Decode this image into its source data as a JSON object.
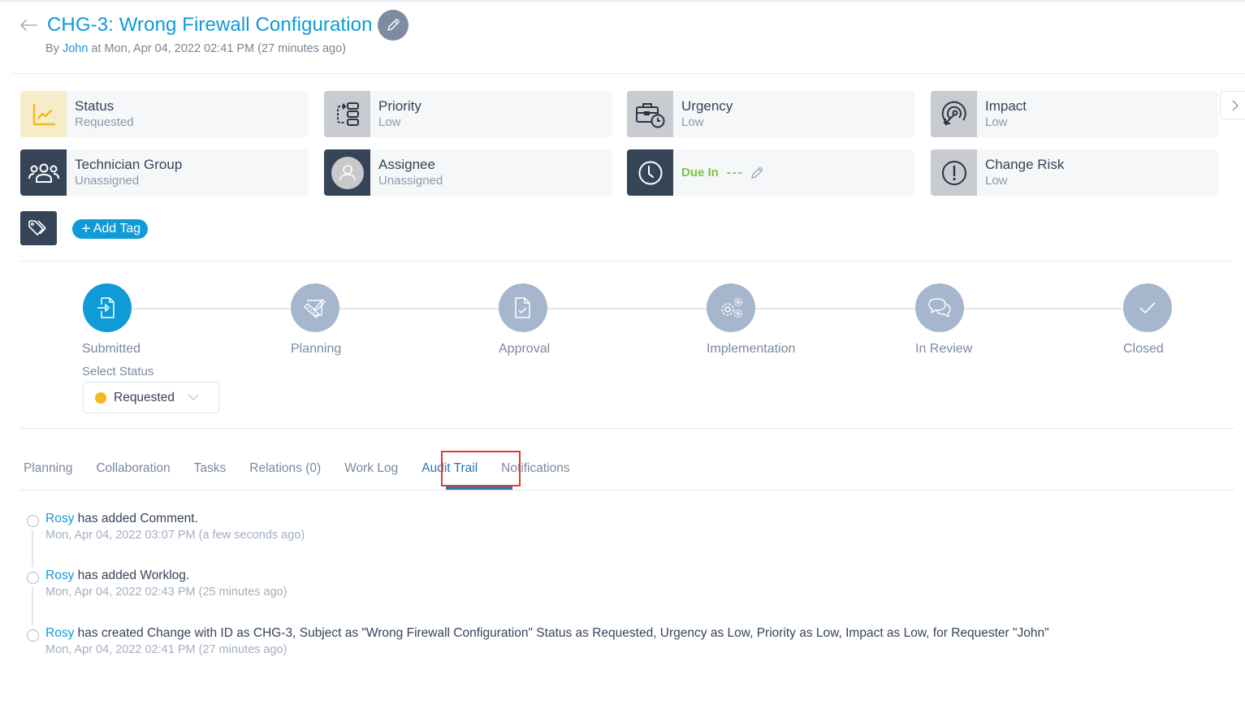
{
  "header": {
    "title": "CHG-3: Wrong Firewall Configuration",
    "by_prefix": "By ",
    "by_user": "John",
    "by_suffix": " at Mon, Apr 04, 2022 02:41 PM (27 minutes ago)"
  },
  "cards": {
    "status": {
      "label": "Status",
      "value": "Requested",
      "icon": "chart-line-icon"
    },
    "priority": {
      "label": "Priority",
      "value": "Low",
      "icon": "priority-flow-icon"
    },
    "urgency": {
      "label": "Urgency",
      "value": "Low",
      "icon": "briefcase-clock-icon"
    },
    "impact": {
      "label": "Impact",
      "value": "Low",
      "icon": "target-icon"
    },
    "technician_group": {
      "label": "Technician Group",
      "value": "Unassigned",
      "icon": "users-group-icon"
    },
    "assignee": {
      "label": "Assignee",
      "value": "Unassigned",
      "icon": "avatar-icon"
    },
    "due": {
      "label": "Due In",
      "value": "---",
      "icon": "clock-icon"
    },
    "change_risk": {
      "label": "Change Risk",
      "value": "Low",
      "icon": "alert-circle-icon"
    }
  },
  "tags": {
    "add_label": "Add Tag"
  },
  "stepper": {
    "steps": [
      {
        "label": "Submitted",
        "active": true
      },
      {
        "label": "Planning",
        "active": false
      },
      {
        "label": "Approval",
        "active": false
      },
      {
        "label": "Implementation",
        "active": false
      },
      {
        "label": "In Review",
        "active": false
      },
      {
        "label": "Closed",
        "active": false
      }
    ],
    "select_label": "Select Status",
    "select_value": "Requested",
    "select_color": "#f6b81c"
  },
  "tabs": [
    {
      "label": "Planning"
    },
    {
      "label": "Collaboration"
    },
    {
      "label": "Tasks"
    },
    {
      "label": "Relations (0)"
    },
    {
      "label": "Work Log"
    },
    {
      "label": "Audit Trail",
      "active": true
    },
    {
      "label": "Notifications"
    }
  ],
  "audit": [
    {
      "user": "Rosy",
      "text": " has added Comment.",
      "time": "Mon, Apr 04, 2022 03:07 PM (a few seconds ago)"
    },
    {
      "user": "Rosy",
      "text": " has added Worklog.",
      "time": "Mon, Apr 04, 2022 02:43 PM (25 minutes ago)"
    },
    {
      "user": "Rosy",
      "text": " has created Change with ID as CHG-3, Subject as \"Wrong Firewall Configuration\" Status as Requested, Urgency as Low, Priority as Low, Impact as Low, for Requester \"John\"",
      "time": "Mon, Apr 04, 2022 02:41 PM (27 minutes ago)"
    }
  ],
  "colors": {
    "accent": "#0f9ad8",
    "tab_active": "#2c74b3",
    "due": "#7dc242",
    "highlight": "#e03a3a"
  }
}
